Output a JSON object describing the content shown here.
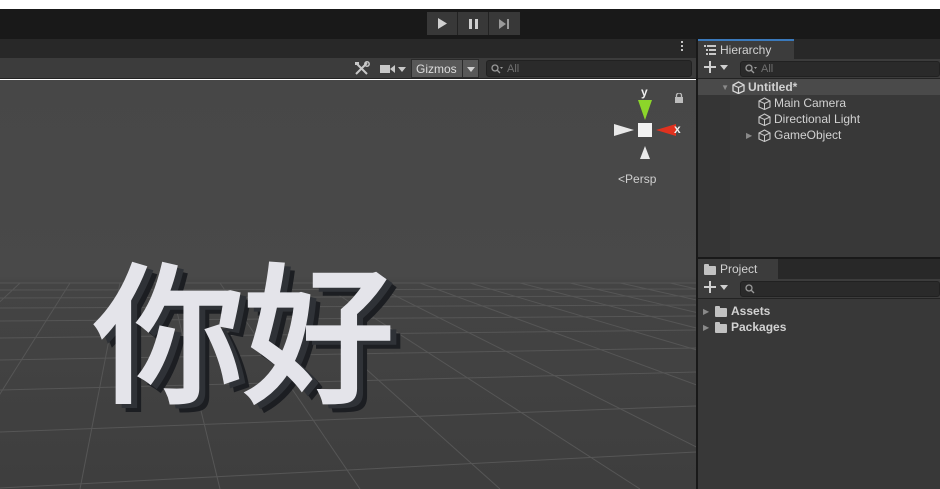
{
  "toolbar": {
    "controls": [
      "play",
      "pause",
      "step"
    ]
  },
  "scene": {
    "gizmos_label": "Gizmos",
    "search_placeholder": "All",
    "projection_label": "Persp",
    "axis_y": "y",
    "axis_x": "x",
    "scene_text": "你好"
  },
  "hierarchy": {
    "tab_label": "Hierarchy",
    "search_placeholder": "All",
    "scene_name": "Untitled*",
    "items": [
      {
        "label": "Main Camera"
      },
      {
        "label": "Directional Light"
      },
      {
        "label": "GameObject"
      }
    ]
  },
  "project": {
    "tab_label": "Project",
    "search_placeholder": "",
    "folders": [
      {
        "label": "Assets"
      },
      {
        "label": "Packages"
      }
    ]
  },
  "colors": {
    "accent_tab": "#3a79bb",
    "gizmo_y": "#8cd62a",
    "gizmo_x": "#e0321f"
  }
}
